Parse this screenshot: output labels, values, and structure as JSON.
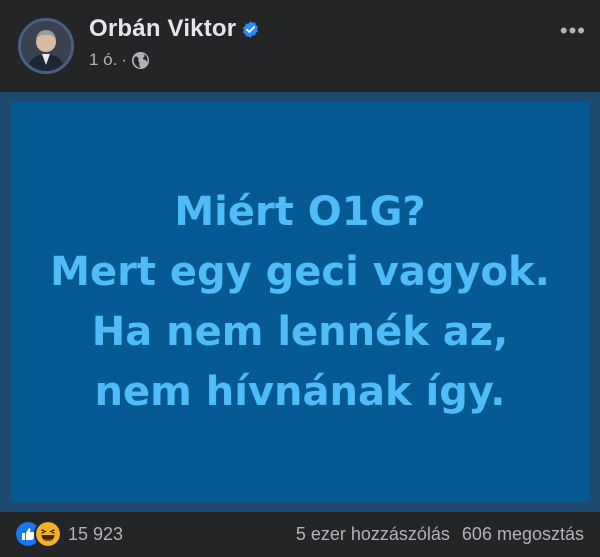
{
  "post": {
    "author": "Orbán Viktor",
    "time": "1 ó.",
    "separator": "·",
    "more_label": "•••",
    "icons": {
      "verified": "verified-badge-icon",
      "audience": "globe-icon",
      "more": "more-options-icon"
    }
  },
  "image": {
    "lines": [
      "Miért O1G?",
      "Mert egy geci vagyok.",
      "Ha nem lennék az,",
      "nem hívnának így."
    ]
  },
  "footer": {
    "reaction_count": "15 923",
    "comments": "5 ezer hozzászólás",
    "shares": "606 megosztás",
    "reactions": [
      "like-reaction-icon",
      "haha-reaction-icon"
    ]
  },
  "colors": {
    "background": "#18191a",
    "card": "#242526",
    "image_bg": "#065a93",
    "image_text": "#4ebcf8",
    "verified": "#2d88ff",
    "secondary_text": "#b0b3b8"
  }
}
